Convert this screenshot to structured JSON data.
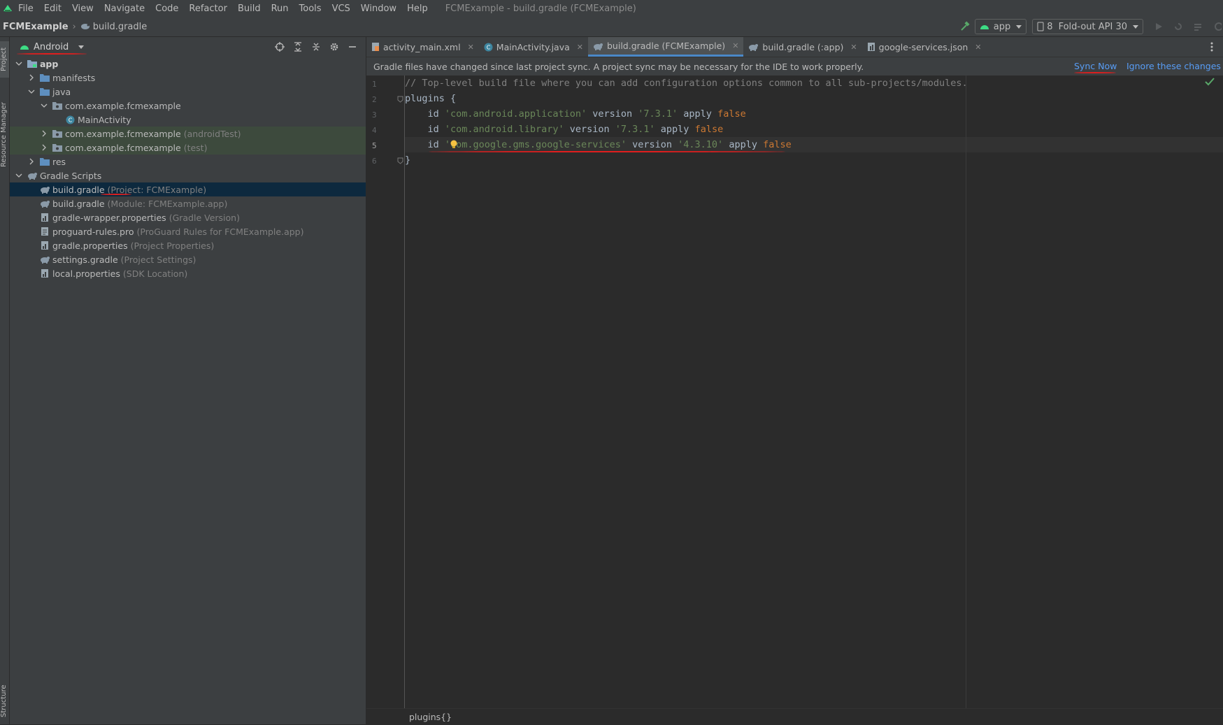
{
  "menubar": {
    "items": [
      "File",
      "Edit",
      "View",
      "Navigate",
      "Code",
      "Refactor",
      "Build",
      "Run",
      "Tools",
      "VCS",
      "Window",
      "Help"
    ],
    "window_title": "FCMExample - build.gradle (FCMExample)"
  },
  "navbar": {
    "project": "FCMExample",
    "file": "build.gradle",
    "run_config": "app",
    "device_count": "8",
    "device": "Fold-out API 30"
  },
  "left_stripe": {
    "project": "Project",
    "resource_manager": "Resource Manager",
    "structure": "Structure"
  },
  "project_panel": {
    "view_mode": "Android",
    "tree": [
      {
        "label": "app",
        "hint": "",
        "level": 0,
        "arrow": "down",
        "icon": "module-folder-icon",
        "bold": true
      },
      {
        "label": "manifests",
        "hint": "",
        "level": 1,
        "arrow": "right",
        "icon": "folder-icon"
      },
      {
        "label": "java",
        "hint": "",
        "level": 1,
        "arrow": "down",
        "icon": "folder-icon"
      },
      {
        "label": "com.example.fcmexample",
        "hint": "",
        "level": 2,
        "arrow": "down",
        "icon": "package-icon"
      },
      {
        "label": "MainActivity",
        "hint": "",
        "level": 3,
        "arrow": "none",
        "icon": "class-icon"
      },
      {
        "label": "com.example.fcmexample",
        "hint": "(androidTest)",
        "level": 2,
        "arrow": "right",
        "icon": "package-icon",
        "green": true
      },
      {
        "label": "com.example.fcmexample",
        "hint": "(test)",
        "level": 2,
        "arrow": "right",
        "icon": "package-icon",
        "green": true
      },
      {
        "label": "res",
        "hint": "",
        "level": 1,
        "arrow": "right",
        "icon": "folder-icon"
      },
      {
        "label": "Gradle Scripts",
        "hint": "",
        "level": 0,
        "arrow": "down",
        "icon": "gradle-icon"
      },
      {
        "label": "build.gradle",
        "hint": "(Project: FCMExample)",
        "level": 1,
        "arrow": "none",
        "icon": "gradle-icon",
        "selected": true
      },
      {
        "label": "build.gradle",
        "hint": "(Module: FCMExample.app)",
        "level": 1,
        "arrow": "none",
        "icon": "gradle-icon"
      },
      {
        "label": "gradle-wrapper.properties",
        "hint": "(Gradle Version)",
        "level": 1,
        "arrow": "none",
        "icon": "properties-icon"
      },
      {
        "label": "proguard-rules.pro",
        "hint": "(ProGuard Rules for FCMExample.app)",
        "level": 1,
        "arrow": "none",
        "icon": "file-icon"
      },
      {
        "label": "gradle.properties",
        "hint": "(Project Properties)",
        "level": 1,
        "arrow": "none",
        "icon": "properties-icon"
      },
      {
        "label": "settings.gradle",
        "hint": "(Project Settings)",
        "level": 1,
        "arrow": "none",
        "icon": "gradle-icon"
      },
      {
        "label": "local.properties",
        "hint": "(SDK Location)",
        "level": 1,
        "arrow": "none",
        "icon": "properties-icon"
      }
    ]
  },
  "editor": {
    "tabs": [
      {
        "label": "activity_main.xml",
        "icon": "xml-icon",
        "active": false
      },
      {
        "label": "MainActivity.java",
        "icon": "class-icon",
        "active": false
      },
      {
        "label": "build.gradle (FCMExample)",
        "icon": "gradle-icon",
        "active": true
      },
      {
        "label": "build.gradle (:app)",
        "icon": "gradle-icon",
        "active": false
      },
      {
        "label": "google-services.json",
        "icon": "json-icon",
        "active": false
      }
    ],
    "banner": {
      "message": "Gradle files have changed since last project sync. A project sync may be necessary for the IDE to work properly.",
      "sync_now": "Sync Now",
      "ignore": "Ignore these changes"
    },
    "line_numbers": [
      "1",
      "2",
      "3",
      "4",
      "5",
      "6"
    ],
    "current_line": 5,
    "code": [
      [
        {
          "t": "// Top-level build file where you can add configuration options common to all sub-projects/modules.",
          "c": "cmt"
        }
      ],
      [
        {
          "t": "plugins {",
          "c": "plain"
        }
      ],
      [
        {
          "t": "    id ",
          "c": "plain"
        },
        {
          "t": "'com.android.application'",
          "c": "str"
        },
        {
          "t": " version ",
          "c": "plain"
        },
        {
          "t": "'7.3.1'",
          "c": "str"
        },
        {
          "t": " apply ",
          "c": "plain"
        },
        {
          "t": "false",
          "c": "kw"
        }
      ],
      [
        {
          "t": "    id ",
          "c": "plain"
        },
        {
          "t": "'com.android.library'",
          "c": "str"
        },
        {
          "t": " version ",
          "c": "plain"
        },
        {
          "t": "'7.3.1'",
          "c": "str"
        },
        {
          "t": " apply ",
          "c": "plain"
        },
        {
          "t": "false",
          "c": "kw"
        }
      ],
      [
        {
          "t": "    id ",
          "c": "plain"
        },
        {
          "t": "'com.google.gms.google-services'",
          "c": "str"
        },
        {
          "t": " version ",
          "c": "plain"
        },
        {
          "t": "'4.3.10'",
          "c": "str"
        },
        {
          "t": " apply ",
          "c": "plain"
        },
        {
          "t": "false",
          "c": "kw"
        }
      ],
      [
        {
          "t": "}",
          "c": "plain"
        }
      ]
    ],
    "status_breadcrumb": "plugins{}"
  },
  "colors": {
    "accent": "#4a88c7",
    "link": "#589df6",
    "annotation_red": "#e01e1e",
    "android_green": "#3ddc84"
  }
}
